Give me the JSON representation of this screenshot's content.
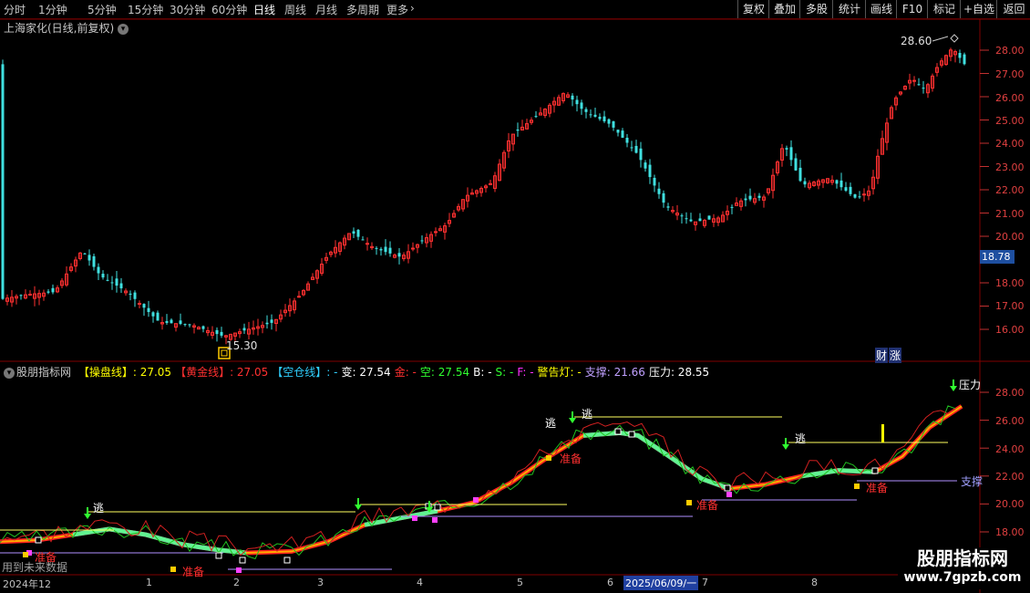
{
  "toolbar": {
    "periods": [
      "分时",
      "1分钟",
      "5分钟",
      "15分钟",
      "30分钟",
      "60分钟",
      "日线",
      "周线",
      "月线",
      "多周期",
      "更多"
    ],
    "active": "日线",
    "right_buttons": [
      "复权",
      "叠加",
      "多股",
      "统计",
      "画线",
      "F10",
      "标记",
      "+自选",
      "返回"
    ]
  },
  "main_panel": {
    "title": "上海家化(日线,前复权)",
    "high_label": "28.60",
    "low_label": "15.30",
    "current_price": "18.78",
    "finance_mark": "财",
    "price_axis": [
      "28.00",
      "27.00",
      "26.00",
      "25.00",
      "24.00",
      "23.00",
      "22.00",
      "21.00",
      "20.00",
      "18.00",
      "17.00",
      "16.00"
    ]
  },
  "indicator_panel": {
    "name": "股朋指标网",
    "items": [
      {
        "label": "【操盘线】",
        "value": ": 27.05",
        "color": "#ffff00"
      },
      {
        "label": "【黄金线】",
        "value": ": 27.05",
        "color": "#ff3030"
      },
      {
        "label": "【空仓线】",
        "value": ": -",
        "color": "#30d0ff"
      },
      {
        "label": "变",
        "value": ": 27.54",
        "color": "#ffffff"
      },
      {
        "label": "金",
        "value": ": -",
        "color": "#ff3030"
      },
      {
        "label": "空",
        "value": ": 27.54",
        "color": "#30ff30"
      },
      {
        "label": "B",
        "value": ": -",
        "color": "#ffffff"
      },
      {
        "label": "S",
        "value": ": -",
        "color": "#30ff30"
      },
      {
        "label": "F",
        "value": ": -",
        "color": "#ff30ff"
      },
      {
        "label": "警告灯",
        "value": ": -",
        "color": "#ffff00"
      },
      {
        "label": "支撑",
        "value": ": 21.66",
        "color": "#c0a0ff"
      },
      {
        "label": "压力",
        "value": ": 28.55",
        "color": "#ffffff"
      }
    ],
    "axis": [
      "28.00",
      "26.00",
      "24.00",
      "22.00",
      "20.00",
      "18.00"
    ],
    "annotations": {
      "escape": "逃",
      "prepare": "准备",
      "support": "支撑",
      "pressure": "压力",
      "future_note": "用到未来数据"
    }
  },
  "date_axis": [
    "2024年12",
    "1",
    "2",
    "3",
    "4",
    "5",
    "6",
    "2025/06/09/一",
    "7",
    "8"
  ],
  "watermark": {
    "title": "股朋指标网",
    "url": "www.7gpzb.com"
  }
}
